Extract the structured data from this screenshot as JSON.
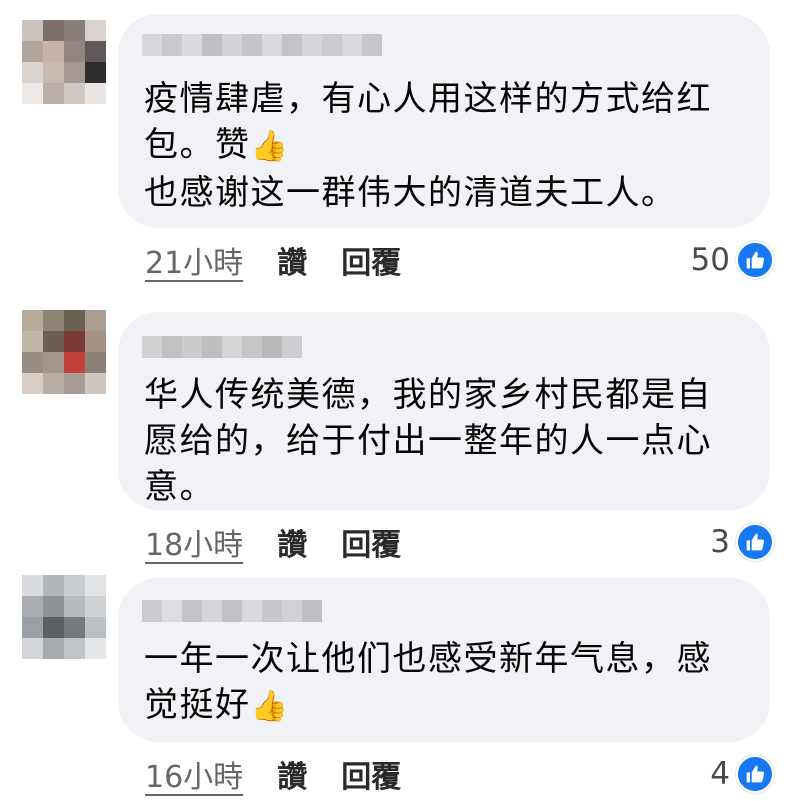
{
  "colors": {
    "bubble": "#f0f2f5",
    "like_badge": "#1877f2",
    "time": "#65676b"
  },
  "comments": [
    {
      "text": "疫情肆虐，有心人用这样的方式给红\n包。赞",
      "thumb": "👍",
      "text2": "也感谢这一群伟大的清道夫工人。",
      "time": "21小時",
      "like": "讚",
      "reply": "回覆",
      "reactions": "50",
      "reaction_icon": "like-icon"
    },
    {
      "text": "华人传统美德，我的家乡村民都是自\n愿给的，给于付出一整年的人一点心\n意。",
      "time": "18小時",
      "like": "讚",
      "reply": "回覆",
      "reactions": "3",
      "reaction_icon": "like-icon"
    },
    {
      "text": "一年一次让他们也感受新年气息，感\n觉挺好",
      "thumb": "👍",
      "time": "16小時",
      "like": "讚",
      "reply": "回覆",
      "reactions": "4",
      "reaction_icon": "like-icon"
    }
  ]
}
